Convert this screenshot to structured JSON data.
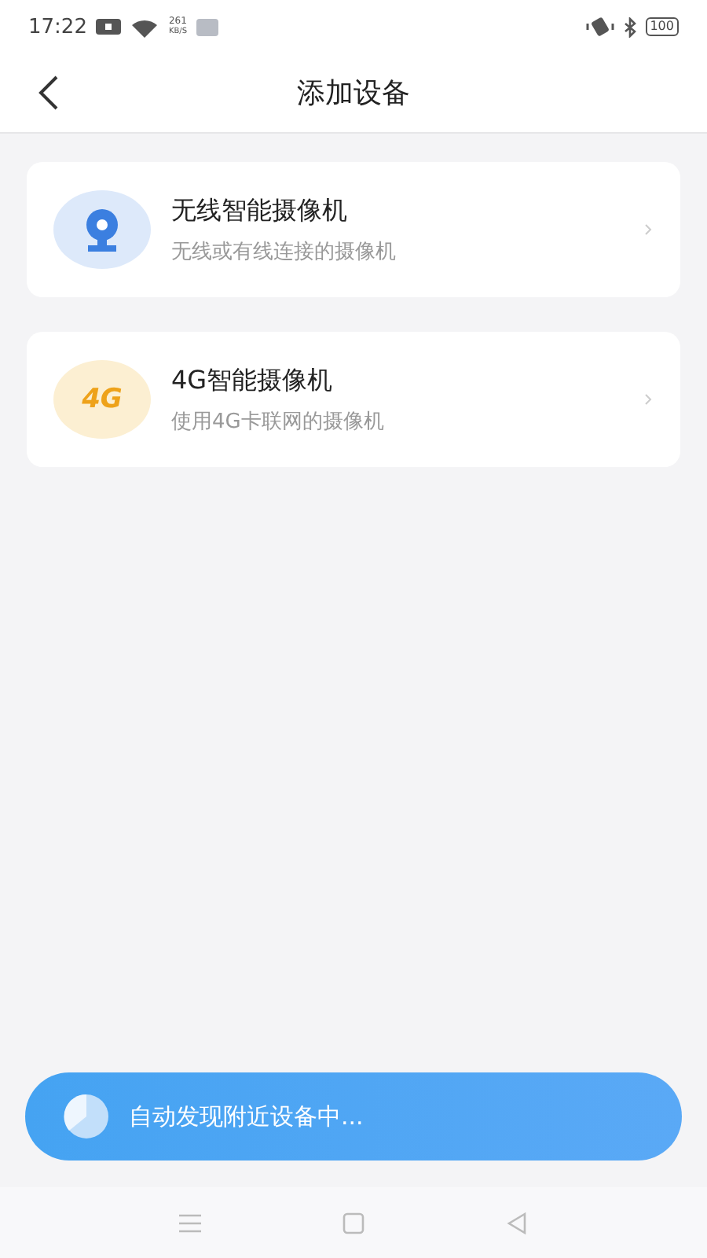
{
  "status_bar": {
    "time": "17:22",
    "speed_value": "261",
    "speed_unit": "KB/S",
    "battery": "100"
  },
  "header": {
    "title": "添加设备"
  },
  "devices": [
    {
      "kind": "wifi",
      "title": "无线智能摄像机",
      "subtitle": "无线或有线连接的摄像机"
    },
    {
      "kind": "cellular",
      "title": "4G智能摄像机",
      "subtitle": "使用4G卡联网的摄像机",
      "icon_text": "4G"
    }
  ],
  "scan_banner": {
    "text": "自动发现附近设备中..."
  }
}
